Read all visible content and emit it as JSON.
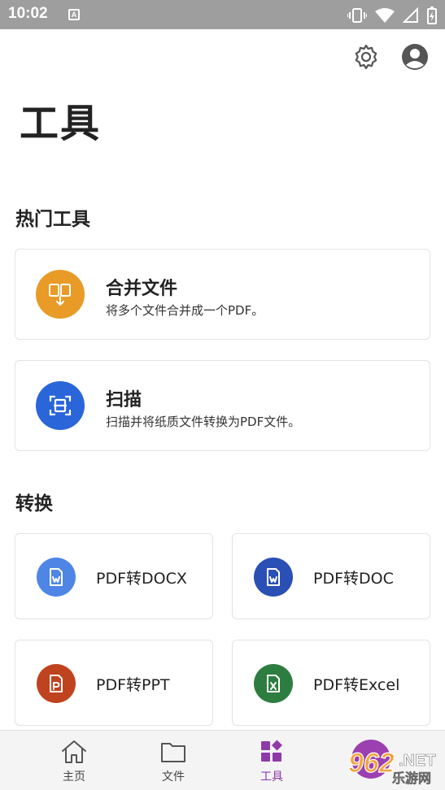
{
  "status_bar": {
    "time": "10:02",
    "a_badge": "A"
  },
  "header": {
    "title": "工具"
  },
  "sections": {
    "hot": "热门工具",
    "convert": "转换"
  },
  "hot_tools": {
    "merge": {
      "title": "合并文件",
      "subtitle": "将多个文件合并成一个PDF。",
      "color": "#e89b26"
    },
    "scan": {
      "title": "扫描",
      "subtitle": "扫描并将纸质文件转换为PDF文件。",
      "color": "#2a66d9"
    }
  },
  "convert_tools": [
    {
      "label": "PDF转DOCX",
      "color": "#4f86e6"
    },
    {
      "label": "PDF转DOC",
      "color": "#2a4fb5"
    },
    {
      "label": "PDF转PPT",
      "color": "#c0431f"
    },
    {
      "label": "PDF转Excel",
      "color": "#2e7d40"
    }
  ],
  "bottom_nav": {
    "home": "主页",
    "files": "文件",
    "tools": "工具"
  },
  "watermark": {
    "number": "962",
    "suffix": ".NET",
    "text": "乐游网"
  },
  "colors": {
    "accent": "#8e3aa8",
    "status_bar": "#9e9e9e"
  }
}
